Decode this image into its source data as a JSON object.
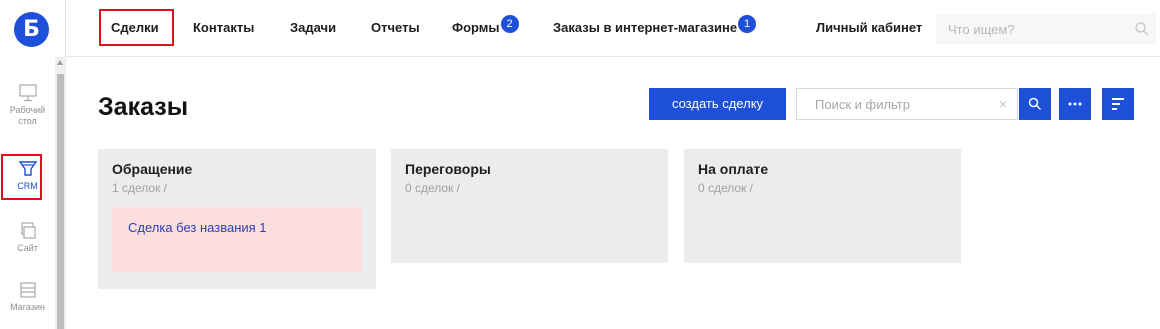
{
  "app": {
    "logo_letter": "Б",
    "brand_color": "#1d4fd8",
    "highlight_color": "#e1101c"
  },
  "rail": {
    "items": [
      {
        "label_line1": "Рабочий",
        "label_line2": "стол",
        "icon": "monitor-icon",
        "active": false
      },
      {
        "label_line1": "CRM",
        "label_line2": "",
        "icon": "funnel-icon",
        "active": true
      },
      {
        "label_line1": "Сайт",
        "label_line2": "",
        "icon": "pages-icon",
        "active": false
      },
      {
        "label_line1": "Магазин",
        "label_line2": "",
        "icon": "shop-icon",
        "active": false
      }
    ]
  },
  "nav": {
    "items": [
      {
        "label": "Сделки",
        "badge": ""
      },
      {
        "label": "Контакты",
        "badge": ""
      },
      {
        "label": "Задачи",
        "badge": ""
      },
      {
        "label": "Отчеты",
        "badge": ""
      },
      {
        "label": "Формы",
        "badge": "2"
      },
      {
        "label": "Заказы в интернет-магазине",
        "badge": "1"
      },
      {
        "label": "Личный кабинет",
        "badge": ""
      }
    ],
    "active_index": 0,
    "search_placeholder": "Что ищем?"
  },
  "main": {
    "title": "Заказы",
    "create_button": "создать сделку",
    "filter_placeholder": "Поиск и фильтр",
    "columns": [
      {
        "title": "Обращение",
        "count": "1 сделок /",
        "cards": [
          {
            "title": "Сделка без названия 1"
          }
        ]
      },
      {
        "title": "Переговоры",
        "count": "0 сделок /",
        "cards": []
      },
      {
        "title": "На оплате",
        "count": "0 сделок /",
        "cards": []
      }
    ]
  }
}
